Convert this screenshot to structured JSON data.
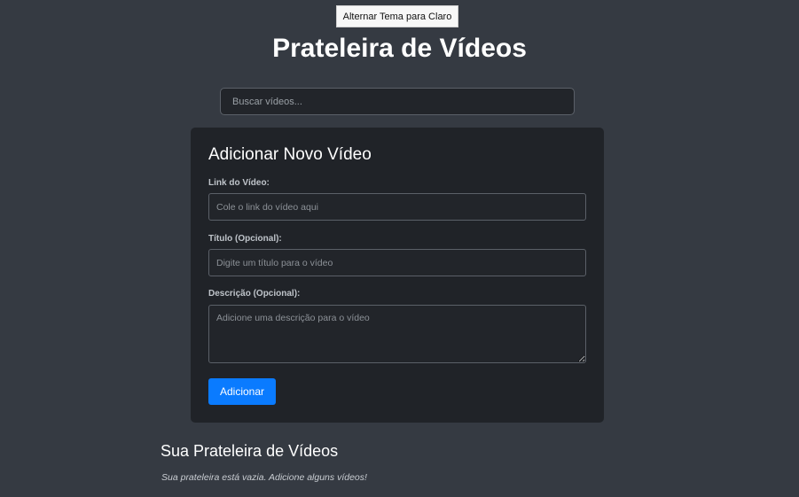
{
  "header": {
    "theme_toggle_label": "Alternar Tema para Claro",
    "title": "Prateleira de Vídeos"
  },
  "search": {
    "placeholder": "Buscar vídeos...",
    "value": ""
  },
  "form": {
    "title": "Adicionar Novo Vídeo",
    "link": {
      "label": "Link do Vídeo:",
      "placeholder": "Cole o link do vídeo aqui",
      "value": ""
    },
    "video_title": {
      "label": "Título (Opcional):",
      "placeholder": "Digite um título para o vídeo",
      "value": ""
    },
    "description": {
      "label": "Descrição (Opcional):",
      "placeholder": "Adicione uma descrição para o vídeo",
      "value": ""
    },
    "submit_label": "Adicionar"
  },
  "shelf": {
    "title": "Sua Prateleira de Vídeos",
    "empty_message": "Sua prateleira está vazia. Adicione alguns vídeos!"
  },
  "colors": {
    "background": "#353a42",
    "card": "#202328",
    "accent": "#0a7bff"
  }
}
